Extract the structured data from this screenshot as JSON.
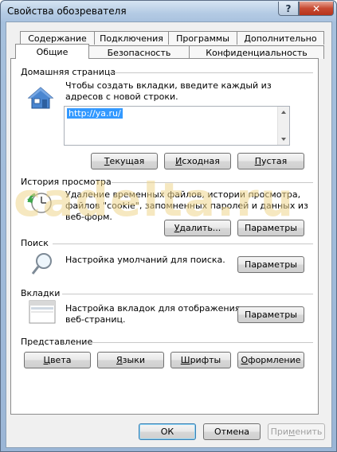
{
  "window": {
    "title": "Свойства обозревателя",
    "help_glyph": "?",
    "close_glyph": "✕"
  },
  "tabs": {
    "row1": [
      "Содержание",
      "Подключения",
      "Программы",
      "Дополнительно"
    ],
    "row2": [
      "Общие",
      "Безопасность",
      "Конфиденциальность"
    ],
    "active": "Общие"
  },
  "home": {
    "label": "Домашняя страница",
    "desc": "Чтобы создать вкладки, введите каждый из адресов с новой строки.",
    "url": "http://ya.ru/",
    "buttons": {
      "current_u": "Т",
      "current_rest": "екущая",
      "default_u": "И",
      "default_rest": "сходная",
      "blank_u": "П",
      "blank_rest": "устая"
    }
  },
  "history": {
    "label": "История просмотра",
    "desc": "Удаление временных файлов, истории просмотра, файлов \"cookie\", запомненных паролей и данных из веб-форм.",
    "delete_u": "У",
    "delete_rest": "далить...",
    "params": "Параметры"
  },
  "search": {
    "label": "Поиск",
    "desc": "Настройка умолчаний для поиска.",
    "params": "Параметры"
  },
  "tabs_section": {
    "label": "Вкладки",
    "desc": "Настройка вкладок для отображения веб-страниц.",
    "params": "Параметры"
  },
  "appearance": {
    "label": "Представление",
    "colors_u": "Ц",
    "colors_rest": "вета",
    "languages_u": "Я",
    "languages_rest": "зыки",
    "fonts_u": "Ш",
    "fonts_rest": "рифты",
    "design_u": "О",
    "design_rest": "формление"
  },
  "footer": {
    "ok": "ОК",
    "cancel": "Отмена",
    "apply_pre": "При",
    "apply_u": "м",
    "apply_rest": "енить"
  },
  "watermark": "cadelta.ru"
}
